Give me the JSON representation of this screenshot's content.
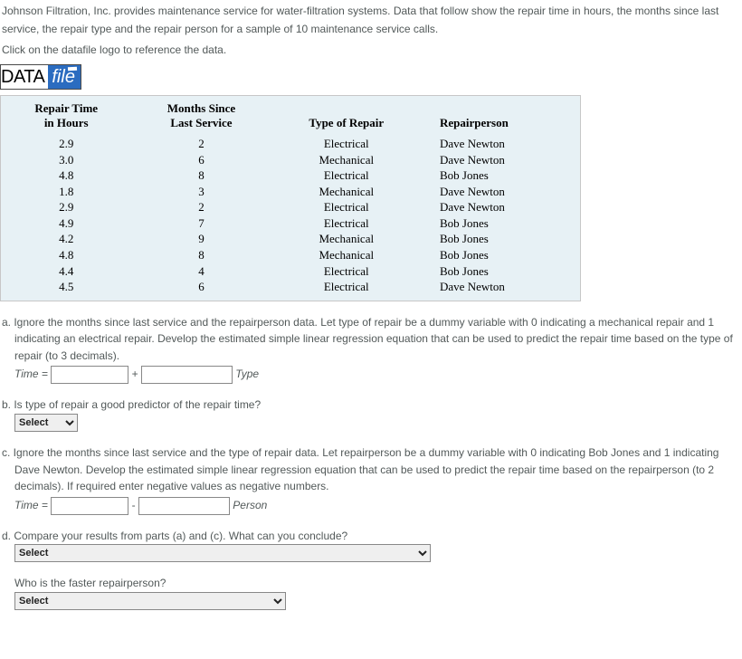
{
  "intro": {
    "p1": "Johnson Filtration, Inc. provides maintenance service for water-filtration systems. Data that follow show the repair time in hours, the months since last service, the repair type and the repair person for a sample of 10 maintenance service calls.",
    "p2": "Click on the datafile logo to reference the data."
  },
  "datafile": {
    "left": "DATA",
    "right": "file"
  },
  "table": {
    "headers": {
      "c1a": "Repair Time",
      "c1b": "in Hours",
      "c2a": "Months Since",
      "c2b": "Last Service",
      "c3": "Type of Repair",
      "c4": "Repairperson"
    },
    "rows": [
      {
        "t": "2.9",
        "m": "2",
        "ty": "Electrical",
        "p": "Dave Newton"
      },
      {
        "t": "3.0",
        "m": "6",
        "ty": "Mechanical",
        "p": "Dave Newton"
      },
      {
        "t": "4.8",
        "m": "8",
        "ty": "Electrical",
        "p": "Bob Jones"
      },
      {
        "t": "1.8",
        "m": "3",
        "ty": "Mechanical",
        "p": "Dave Newton"
      },
      {
        "t": "2.9",
        "m": "2",
        "ty": "Electrical",
        "p": "Dave Newton"
      },
      {
        "t": "4.9",
        "m": "7",
        "ty": "Electrical",
        "p": "Bob Jones"
      },
      {
        "t": "4.2",
        "m": "9",
        "ty": "Mechanical",
        "p": "Bob Jones"
      },
      {
        "t": "4.8",
        "m": "8",
        "ty": "Mechanical",
        "p": "Bob Jones"
      },
      {
        "t": "4.4",
        "m": "4",
        "ty": "Electrical",
        "p": "Bob Jones"
      },
      {
        "t": "4.5",
        "m": "6",
        "ty": "Electrical",
        "p": "Dave Newton"
      }
    ]
  },
  "qa": {
    "label": "a. ",
    "text": "Ignore the months since last service and the repairperson data. Let type of repair be a dummy variable with 0 indicating a mechanical repair and 1 indicating an electrical repair. Develop the estimated simple linear regression equation that can be used to predict the repair time based on the type of repair (to 3 decimals).",
    "eq_lhs": "Time = ",
    "plus": " + ",
    "term": " Type"
  },
  "qb": {
    "label": "b. ",
    "text": "Is type of repair a good predictor of the repair time?",
    "select_placeholder": "Select"
  },
  "qc": {
    "label": "c. ",
    "text": "Ignore the months since last service and the type of repair data. Let repairperson be a dummy variable with 0 indicating Bob Jones and 1 indicating Dave Newton. Develop the estimated simple linear regression equation that can be used to predict the repair time based on the repairperson (to 2 decimals). If required enter negative values as negative numbers.",
    "eq_lhs": "Time = ",
    "minus": " - ",
    "term": " Person"
  },
  "qd": {
    "label": "d. ",
    "text": "Compare your results from parts (a) and (c). What can you conclude?",
    "select_placeholder": "Select",
    "sub_q": "Who is the faster repairperson?",
    "sub_select_placeholder": "Select"
  }
}
